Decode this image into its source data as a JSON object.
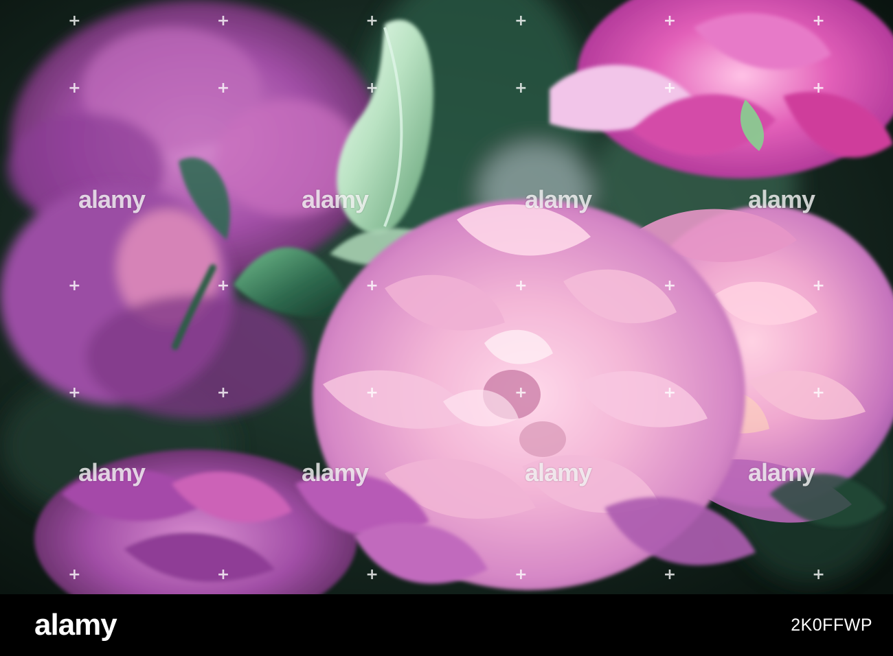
{
  "photo": {
    "subject": "pink-peony-flowers",
    "colors": {
      "background": "#0f1d18",
      "leaf": "#2f6b4f",
      "pale_petal": "#f2b6d7",
      "magenta_petal": "#cf4faa",
      "violet_petal": "#9c4aa6"
    }
  },
  "watermark": {
    "text": "alamy",
    "plus_symbol": "+"
  },
  "footer": {
    "logo_text": "alamy",
    "image_id": "2K0FFWP"
  }
}
